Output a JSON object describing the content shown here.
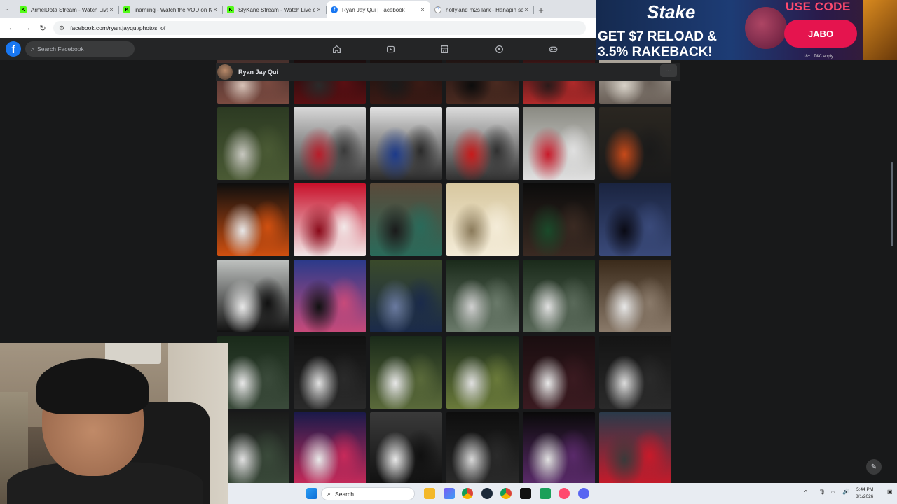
{
  "browser": {
    "tabs": [
      {
        "title": "ArmelDota Stream - Watch Live",
        "icon": "kick",
        "active": false
      },
      {
        "title": "inamiing - Watch the VOD on K",
        "icon": "kick",
        "active": false
      },
      {
        "title": "SlyKane Stream - Watch Live o",
        "icon": "kick",
        "active": false
      },
      {
        "title": "Ryan Jay Qui | Facebook",
        "icon": "facebook",
        "active": true
      },
      {
        "title": "hollyland m2s lark - Hanapin sa",
        "icon": "google",
        "active": false
      }
    ],
    "new_tab": "+",
    "tab_search": "⌄",
    "url": "facebook.com/ryan.jayqui/photos_of",
    "back": "←",
    "forward": "→",
    "reload": "↻"
  },
  "ad": {
    "brand": "Stake",
    "headline_line1": "GET $7 RELOAD &",
    "headline_line2": "3.5% RAKEBACK!",
    "use_code": "USE CODE",
    "code": "JABO",
    "terms": "18+ | T&C apply",
    "brand_color": "#e5144e"
  },
  "facebook": {
    "logo": "f",
    "search_placeholder": "Search Facebook",
    "nav_icons": [
      "home-icon",
      "video-icon",
      "marketplace-icon",
      "groups-icon",
      "gaming-icon"
    ],
    "profile_name": "Ryan Jay Qui",
    "more": "···",
    "compose_icon": "✎"
  },
  "photos": [
    {
      "row": 0,
      "colors": [
        "#3c2a28",
        "#7a4a40",
        "#d9c4b9"
      ]
    },
    {
      "row": 0,
      "colors": [
        "#0d0d0d",
        "#5a0f12",
        "#2a2a2a"
      ]
    },
    {
      "row": 0,
      "colors": [
        "#121010",
        "#3a1a14",
        "#1a1a1a"
      ]
    },
    {
      "row": 0,
      "colors": [
        "#181010",
        "#4a2a20",
        "#0c0c0c"
      ]
    },
    {
      "row": 0,
      "colors": [
        "#1a0f0f",
        "#b02a2a",
        "#2a1a1a"
      ]
    },
    {
      "row": 0,
      "colors": [
        "#b8b2a8",
        "#6a6058",
        "#d8d2c8"
      ]
    },
    {
      "row": 1,
      "colors": [
        "#2c3a22",
        "#4a5a34",
        "#c8c8c0"
      ]
    },
    {
      "row": 1,
      "colors": [
        "#d8d8d8",
        "#3a3a3a",
        "#b81d2a"
      ]
    },
    {
      "row": 1,
      "colors": [
        "#e2e2e2",
        "#2a2a2a",
        "#1c3a8a"
      ]
    },
    {
      "row": 1,
      "colors": [
        "#dcdcdc",
        "#303030",
        "#c81a1a"
      ]
    },
    {
      "row": 1,
      "colors": [
        "#8a8a82",
        "#e0e0e0",
        "#c81a2a"
      ]
    },
    {
      "row": 1,
      "colors": [
        "#2a2620",
        "#1a1a1a",
        "#c84a1a"
      ]
    },
    {
      "row": 2,
      "colors": [
        "#0e0e0e",
        "#d05010",
        "#e8e8e8"
      ]
    },
    {
      "row": 2,
      "colors": [
        "#c8102a",
        "#f2e8e8",
        "#8a0a1a"
      ]
    },
    {
      "row": 2,
      "colors": [
        "#5a4a3a",
        "#2a6a5a",
        "#1a1a1a"
      ]
    },
    {
      "row": 2,
      "colors": [
        "#d8c8a0",
        "#f4ecd8",
        "#8a7a5a"
      ]
    },
    {
      "row": 2,
      "colors": [
        "#0c0c0c",
        "#3a2a22",
        "#1a4a2a"
      ]
    },
    {
      "row": 2,
      "colors": [
        "#1a2440",
        "#3a4a7a",
        "#0a0a14"
      ]
    },
    {
      "row": 3,
      "colors": [
        "#bfc2c0",
        "#101010",
        "#e8e8e8"
      ]
    },
    {
      "row": 3,
      "colors": [
        "#2a3a8a",
        "#c84a7a",
        "#111111"
      ]
    },
    {
      "row": 3,
      "colors": [
        "#3a4a2a",
        "#1a2a4a",
        "#6a7aa0"
      ]
    },
    {
      "row": 3,
      "colors": [
        "#1a2a1a",
        "#6a7a6a",
        "#d0d0d0"
      ]
    },
    {
      "row": 3,
      "colors": [
        "#1a2a1a",
        "#5a6a5a",
        "#e0e0e0"
      ]
    },
    {
      "row": 3,
      "colors": [
        "#3a2a1a",
        "#8a7a6a",
        "#e8e8e8"
      ]
    },
    {
      "row": 4,
      "colors": [
        "#1a2a1a",
        "#3a4a3a",
        "#e8e8e8"
      ]
    },
    {
      "row": 4,
      "colors": [
        "#101010",
        "#2a2a2a",
        "#e0e0e0"
      ]
    },
    {
      "row": 4,
      "colors": [
        "#1a2a1a",
        "#5a6a3a",
        "#e8e8e8"
      ]
    },
    {
      "row": 4,
      "colors": [
        "#1a2a1a",
        "#6a7a3a",
        "#e0e0e0"
      ]
    },
    {
      "row": 4,
      "colors": [
        "#1a0e10",
        "#3a1a20",
        "#e8e8e8"
      ]
    },
    {
      "row": 4,
      "colors": [
        "#141414",
        "#2a2a2a",
        "#dcdcdc"
      ]
    },
    {
      "row": 5,
      "colors": [
        "#1a1a1a",
        "#3a4a3a",
        "#e0e0e0"
      ]
    },
    {
      "row": 5,
      "colors": [
        "#1a1a4a",
        "#c82a5a",
        "#e8e8e8"
      ]
    },
    {
      "row": 5,
      "colors": [
        "#3a3a3a",
        "#101010",
        "#e8e8e8"
      ]
    },
    {
      "row": 5,
      "colors": [
        "#0e0e0e",
        "#2a2a2a",
        "#d8d8d8"
      ]
    },
    {
      "row": 5,
      "colors": [
        "#0a0a0a",
        "#5a2a6a",
        "#e0e0e0"
      ]
    },
    {
      "row": 5,
      "colors": [
        "#2a3a4a",
        "#c81a2a",
        "#3a3a3a"
      ]
    }
  ],
  "taskbar": {
    "search_label": "Search",
    "time": "5:44 PM",
    "date": "8/1/2026",
    "tray_chevron": "^"
  }
}
